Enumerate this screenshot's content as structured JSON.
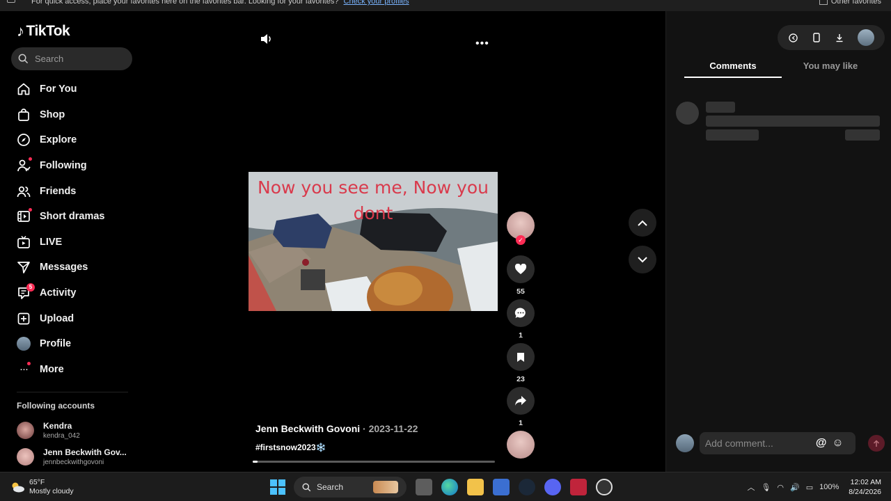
{
  "favbar": {
    "text": "For quick access, place your favorites here on the favorites bar. Looking for your favorites?",
    "link": "Check your profiles",
    "other": "Other favorites"
  },
  "app": {
    "logo": "TikTok",
    "search_placeholder": "Search"
  },
  "nav": [
    {
      "label": "For You",
      "icon": "home-icon"
    },
    {
      "label": "Shop",
      "icon": "shop-bag-icon"
    },
    {
      "label": "Explore",
      "icon": "compass-icon"
    },
    {
      "label": "Following",
      "icon": "following-person-icon"
    },
    {
      "label": "Friends",
      "icon": "friends-icon"
    },
    {
      "label": "Short dramas",
      "icon": "film-icon"
    },
    {
      "label": "LIVE",
      "icon": "live-tv-icon"
    },
    {
      "label": "Messages",
      "icon": "send-icon"
    },
    {
      "label": "Activity",
      "icon": "activity-icon",
      "badge": "5"
    },
    {
      "label": "Upload",
      "icon": "upload-plus-icon"
    },
    {
      "label": "Profile",
      "icon": "profile-avatar"
    },
    {
      "label": "More",
      "icon": "more-dots-icon"
    }
  ],
  "following_accounts": {
    "title": "Following accounts",
    "items": [
      {
        "name": "Kendra",
        "handle": "kendra_042"
      },
      {
        "name": "Jenn Beckwith Gov...",
        "handle": "jennbeckwithgovoni"
      }
    ]
  },
  "video": {
    "caption": "Now you see me, Now you dont",
    "author": "Jenn Beckwith Govoni",
    "date": " · 2023-11-22",
    "hashtag": "#firstsnow2023❄️",
    "progress": 0.02
  },
  "actions": {
    "likes": "55",
    "comments": "1",
    "saves": "23",
    "shares": "1"
  },
  "panel": {
    "tabs": [
      "Comments",
      "You may like"
    ],
    "comment_placeholder": "Add comment...",
    "at_symbol": "@"
  },
  "taskbar": {
    "temp": "65°F",
    "condition": "Mostly cloudy",
    "search": "Search",
    "battery": "100%",
    "time": "12:02 AM",
    "date": "8/24/2026"
  },
  "colors": {
    "accent": "#fe2c55",
    "bg": "#000000",
    "panel": "#121212"
  }
}
